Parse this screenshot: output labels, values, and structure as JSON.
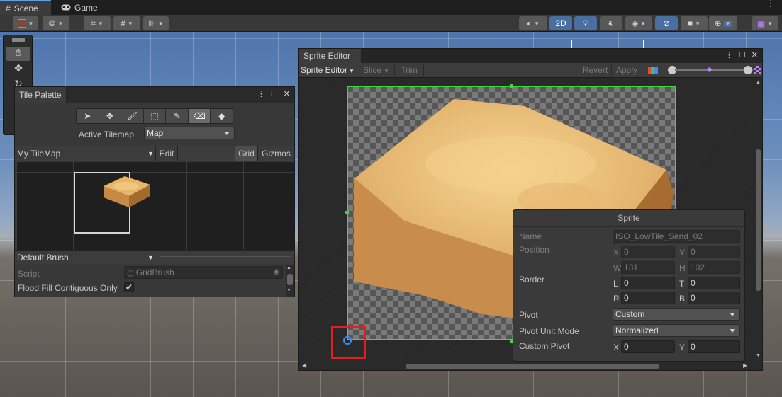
{
  "tabs": [
    {
      "label": "Scene"
    },
    {
      "label": "Game"
    }
  ],
  "toolbar": {
    "two_d_label": "2D"
  },
  "tile_palette": {
    "title": "Tile Palette",
    "active_tilemap_label": "Active Tilemap",
    "active_tilemap_value": "Map",
    "palette_name": "My TileMap",
    "edit_label": "Edit",
    "grid_label": "Grid",
    "gizmos_label": "Gizmos",
    "brush_name": "Default Brush",
    "script_label": "Script",
    "script_value": "GridBrush",
    "flood_fill_label": "Flood Fill Contiguous Only",
    "flood_fill_checked": true
  },
  "sprite_editor": {
    "title": "Sprite Editor",
    "mode_label": "Sprite Editor",
    "slice_label": "Slice",
    "trim_label": "Trim",
    "revert_label": "Revert",
    "apply_label": "Apply"
  },
  "sprite_panel": {
    "header": "Sprite",
    "name_label": "Name",
    "name_value": "ISO_LowTile_Sand_02",
    "position_label": "Position",
    "x_label": "X",
    "x_value": "0",
    "y_label": "Y",
    "y_value": "0",
    "w_label": "W",
    "w_value": "131",
    "h_label": "H",
    "h_value": "102",
    "border_label": "Border",
    "l_label": "L",
    "l_value": "0",
    "t_label": "T",
    "t_value": "0",
    "r_label": "R",
    "r_value": "0",
    "b_label": "B",
    "b_value": "0",
    "pivot_label": "Pivot",
    "pivot_value": "Custom",
    "pivot_unit_label": "Pivot Unit Mode",
    "pivot_unit_value": "Normalized",
    "custom_pivot_label": "Custom Pivot",
    "cp_x_label": "X",
    "cp_x_value": "0",
    "cp_y_label": "Y",
    "cp_y_value": "0"
  },
  "colors": {
    "selection": "#33e033",
    "highlight_box": "#e02020",
    "pivot": "#3a8fff"
  }
}
